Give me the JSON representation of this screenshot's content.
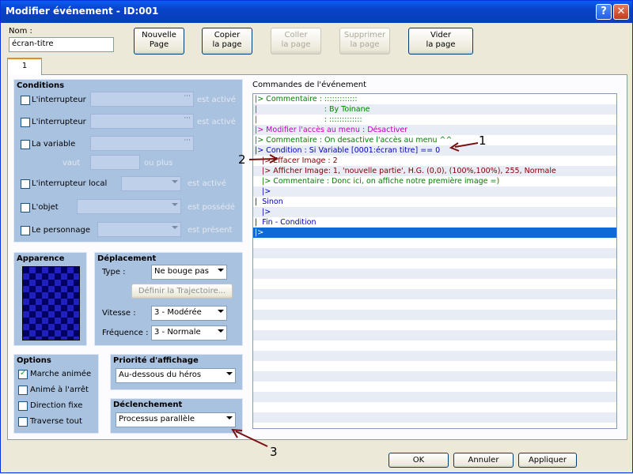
{
  "window": {
    "title": "Modifier événement - ID:001",
    "help": "?",
    "close": "✕"
  },
  "name": {
    "label": "Nom :",
    "value": "écran-titre"
  },
  "toolbar": [
    {
      "l1": "Nouvelle",
      "l2": "Page",
      "enabled": true
    },
    {
      "l1": "Copier",
      "l2": "la page",
      "enabled": true
    },
    {
      "l1": "Coller",
      "l2": "la page",
      "enabled": false
    },
    {
      "l1": "Supprimer",
      "l2": "la page",
      "enabled": false
    },
    {
      "l1": "Vider",
      "l2": "la page",
      "enabled": true
    }
  ],
  "tab": "1",
  "conditions": {
    "title": "Conditions",
    "switch1": {
      "label": "L'interrupteur",
      "suffix": "est activé"
    },
    "switch2": {
      "label": "L'interrupteur",
      "suffix": "est activé"
    },
    "variable": {
      "label": "La variable",
      "vaut": "vaut",
      "suffix": "ou plus"
    },
    "local": {
      "label": "L'interrupteur local",
      "suffix": "est activé"
    },
    "item": {
      "label": "L'objet",
      "suffix": "est possédé"
    },
    "actor": {
      "label": "Le personnage",
      "suffix": "est présent"
    },
    "dots": "···"
  },
  "appearance": {
    "title": "Apparence"
  },
  "movement": {
    "title": "Déplacement",
    "type_label": "Type :",
    "type_value": "Ne bouge pas",
    "route_button": "Définir la Trajectoire...",
    "speed_label": "Vitesse :",
    "speed_value": "3 - Modérée",
    "freq_label": "Fréquence :",
    "freq_value": "3 - Normale"
  },
  "options": {
    "title": "Options",
    "items": [
      {
        "label": "Marche animée",
        "checked": true
      },
      {
        "label": "Animé à l'arrêt",
        "checked": false
      },
      {
        "label": "Direction fixe",
        "checked": false
      },
      {
        "label": "Traverse tout",
        "checked": false
      }
    ]
  },
  "priority": {
    "title": "Priorité d'affichage",
    "value": "Au-dessous du héros"
  },
  "trigger": {
    "title": "Déclenchement",
    "value": "Processus parallèle"
  },
  "commands": {
    "title": "Commandes de l'événement",
    "lines": [
      {
        "text": "|> Commentaire : :::::::::::::",
        "color": "#008000"
      },
      {
        "text": "|                            : By Toinane",
        "color": "#008000"
      },
      {
        "text": "|                            : :::::::::::::",
        "color": "#008000"
      },
      {
        "text": "|> Modifier l'accès au menu : Désactiver",
        "color": "#c000c0"
      },
      {
        "text": "|> Commentaire : On desactive l'accès au menu ^^",
        "color": "#008000"
      },
      {
        "text": "|> Condition : Si Variable [0001:écran titre] == 0",
        "color": "#0000c0"
      },
      {
        "text": "   |> Effacer Image : 2",
        "color": "#800000"
      },
      {
        "text": "   |> Afficher Image: 1, 'nouvelle partie', H.G. (0,0), (100%,100%), 255, Normale",
        "color": "#800000"
      },
      {
        "text": "   |> Commentaire : Donc ici, on affiche notre première image =)",
        "color": "#008000"
      },
      {
        "text": "   |>",
        "color": "#0000c0"
      },
      {
        "text": "|  Sinon",
        "color": "#0000c0"
      },
      {
        "text": "   |>",
        "color": "#0000c0"
      },
      {
        "text": "|  Fin - Condition",
        "color": "#0000c0"
      },
      {
        "text": "|>",
        "color": "#ffffff"
      }
    ]
  },
  "annotations": {
    "a1": "1",
    "a2": "2",
    "a3": "3"
  },
  "footer": {
    "ok": "OK",
    "cancel": "Annuler",
    "apply": "Appliquer"
  }
}
